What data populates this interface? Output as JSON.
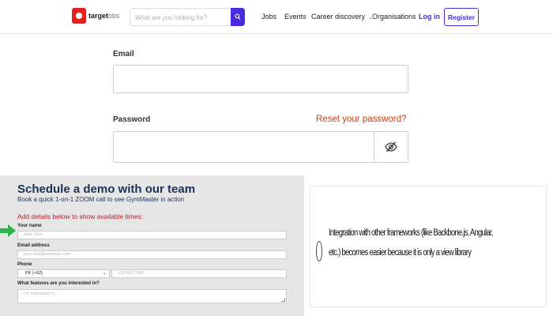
{
  "navbar": {
    "logo_brand": "target",
    "logo_suffix": "obs",
    "search_placeholder": "What are you looking for?",
    "nav_jobs": "Jobs",
    "nav_events": "Events",
    "nav_career": "Career discovery",
    "nav_orgs": "Organisations",
    "login": "Log in",
    "register": "Register"
  },
  "login_form": {
    "email_label": "Email",
    "email_value": "",
    "password_label": "Password",
    "password_value": "",
    "reset_link": "Reset your password?",
    "show_password_icon": "eye-slash-icon"
  },
  "demo": {
    "title": "Schedule a demo with our team",
    "subtitle": "Book a quick 1-on-1 ZOOM call to see GymMaster in action",
    "instructions": "Add details below to show available times:",
    "name_label": "Your name",
    "name_placeholder": "Jane Doe",
    "email_label": "Email address",
    "email_placeholder": "jane.doe@example.com",
    "phone_label": "Phone",
    "country_code": "PK (+92)",
    "phone_placeholder": "123 456 7890",
    "features_label": "What features are you interested in?",
    "features_placeholder": "I'm interested in..."
  },
  "note": {
    "text": "Integration with other frameworks (like Backbone.js, Angular, etc.) becomes easier because it is only a view library"
  },
  "colors": {
    "brand": "#4b2bdd",
    "logo_red": "#e0211d",
    "reset_link": "#c4411b",
    "demo_title": "#1e3258",
    "demo_instructions": "#b1252b",
    "arrow_green": "#2fb34a"
  }
}
